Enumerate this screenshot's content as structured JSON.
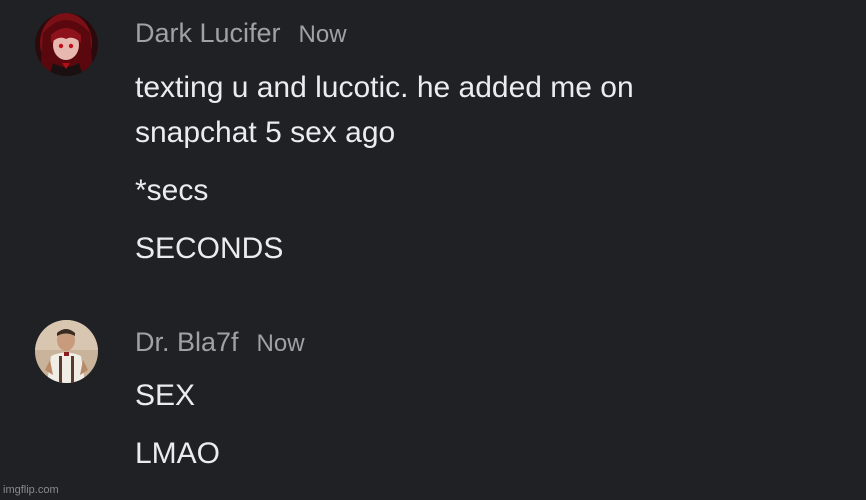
{
  "threads": [
    {
      "username": "Dark Lucifer",
      "timestamp": "Now",
      "avatar_icon": "anime-girl-red-avatar",
      "messages": [
        "texting u and lucotic. he added me on",
        "snapchat 5 sex ago",
        "*secs",
        "SECONDS"
      ]
    },
    {
      "username": "Dr. Bla7f",
      "timestamp": "Now",
      "avatar_icon": "medic-character-avatar",
      "messages": [
        "SEX",
        "LMAO"
      ]
    }
  ],
  "watermark": "imgflip.com",
  "colors": {
    "background": "#202124",
    "text": "#ececee",
    "meta_text": "#a0a0a6"
  }
}
